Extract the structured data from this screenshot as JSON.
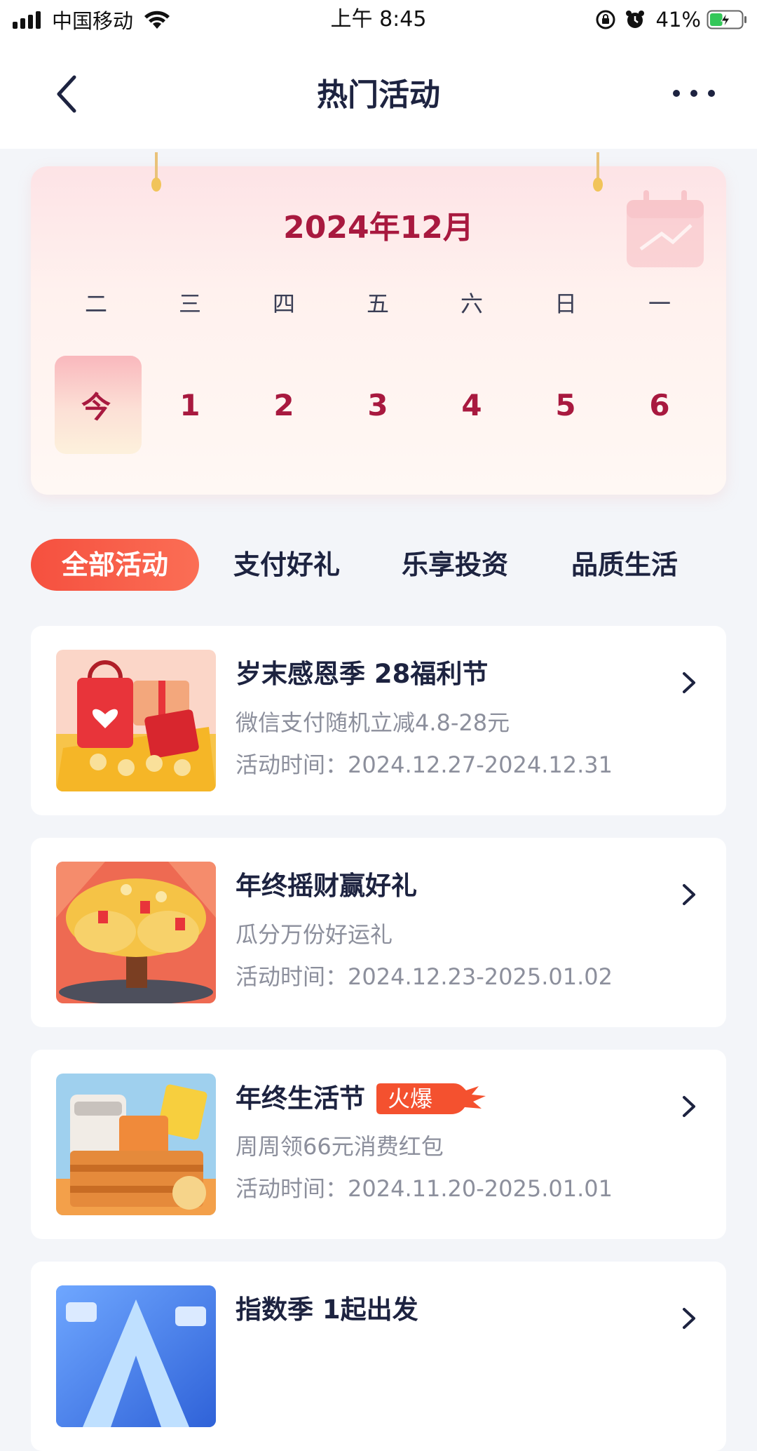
{
  "status_bar": {
    "carrier": "中国移动",
    "time": "上午 8:45",
    "battery_percent": "41%",
    "battery_level": 0.41,
    "icons": [
      "signal-icon",
      "wifi-icon",
      "rotation-lock-icon",
      "alarm-icon",
      "battery-charging-icon"
    ]
  },
  "nav": {
    "title": "热门活动",
    "back_icon": "chevron-left-icon",
    "more_icon": "more-dots-icon"
  },
  "calendar": {
    "month_title": "2024年12月",
    "weekdays": [
      "二",
      "三",
      "四",
      "五",
      "六",
      "日",
      "一"
    ],
    "days": [
      "今",
      "1",
      "2",
      "3",
      "4",
      "5",
      "6"
    ],
    "selected_day": "今"
  },
  "tabs": [
    {
      "label": "全部活动",
      "active": true
    },
    {
      "label": "支付好礼",
      "active": false
    },
    {
      "label": "乐享投资",
      "active": false
    },
    {
      "label": "品质生活",
      "active": false
    }
  ],
  "activities": [
    {
      "title": "岁末感恩季 28福利节",
      "subtitle": "微信支付随机立减4.8-28元",
      "time": "活动时间：2024.12.27-2024.12.31",
      "badge": ""
    },
    {
      "title": "年终摇财赢好礼",
      "subtitle": "瓜分万份好运礼",
      "time": "活动时间：2024.12.23-2025.01.02",
      "badge": ""
    },
    {
      "title": "年终生活节",
      "subtitle": "周周领66元消费红包",
      "time": "活动时间：2024.11.20-2025.01.01",
      "badge": "火爆"
    },
    {
      "title": "指数季 1起出发",
      "subtitle": "",
      "time": "",
      "badge": ""
    }
  ],
  "colors": {
    "accent_red": "#a8193f",
    "tab_active": "#f5503f",
    "text_primary": "#1d2340",
    "text_secondary": "#8c8f9c",
    "background": "#f3f5f9"
  }
}
